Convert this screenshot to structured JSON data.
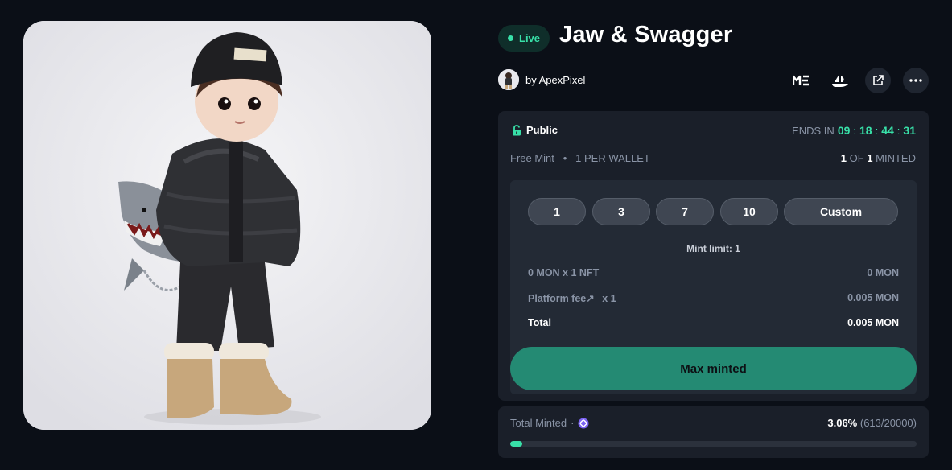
{
  "header": {
    "status": "Live",
    "title": "Jaw & Swagger",
    "creator_text": "by ApexPixel"
  },
  "icons": {
    "marketplace_1": "magic-eden-icon",
    "marketplace_2": "opensea-icon",
    "external": "external-link-icon",
    "more": "more-icon"
  },
  "phase": {
    "label": "Public",
    "ends_label": "ENDS IN",
    "countdown": [
      "09",
      "18",
      "44",
      "31"
    ],
    "price_label": "Free Mint",
    "per_wallet": "1 PER WALLET",
    "minted_count": "1",
    "minted_of": "OF",
    "minted_total": "1",
    "minted_suffix": "MINTED"
  },
  "mint": {
    "quantities": [
      "1",
      "3",
      "7",
      "10",
      "Custom"
    ],
    "mint_limit": "Mint limit: 1",
    "line1_label": "0 MON x 1 NFT",
    "line1_value": "0 MON",
    "fee_label": "Platform fee",
    "fee_arrow": "↗",
    "fee_mult": "x 1",
    "fee_value": "0.005 MON",
    "total_label": "Total",
    "total_value": "0.005 MON",
    "button_label": "Max minted"
  },
  "total_minted": {
    "label": "Total Minted",
    "dot": "·",
    "percent": "3.06%",
    "detail": "(613/20000)",
    "progress_fraction": 0.0306
  },
  "colors": {
    "accent": "#38e0a8",
    "button": "#248a73",
    "background": "#0b0f17",
    "card": "#1a1f29"
  }
}
